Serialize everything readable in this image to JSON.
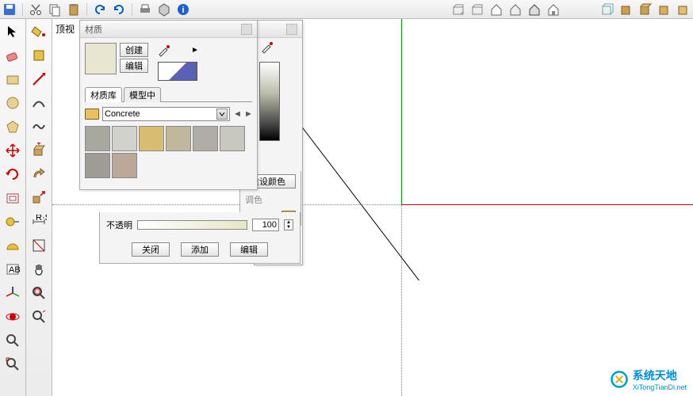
{
  "view_label": "顶视",
  "panel_materials": {
    "title": "材质",
    "create_btn": "创建",
    "edit_btn": "编辑",
    "tab_library": "材质库",
    "tab_model": "模型中",
    "dropdown_value": "Concrete",
    "swatch_colors": [
      "#a8a8a0",
      "#d2d2cc",
      "#d8bc70",
      "#bfb89c",
      "#b0aea4",
      "#c8c8c0",
      "#9e9c94",
      "#bca898"
    ]
  },
  "panel_editor": {
    "reset_color": "重设颜色",
    "tint": "调色",
    "opacity_label": "不透明",
    "opacity_value": "100",
    "close_btn": "关闭",
    "add_btn": "添加",
    "edit_btn": "编辑"
  },
  "watermark": {
    "line1": "系统天地",
    "line2": "XiTongTianDi.net"
  }
}
